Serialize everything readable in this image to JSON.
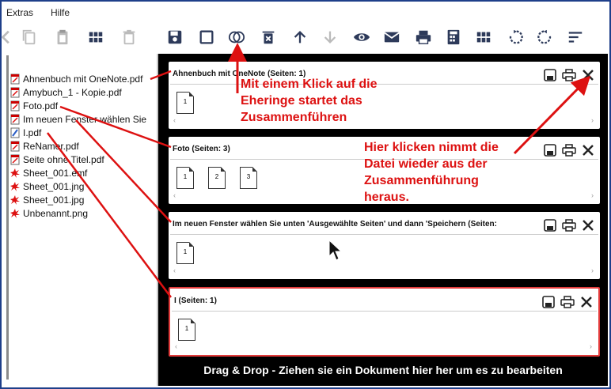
{
  "menu": {
    "items": [
      "Extras",
      "Hilfe"
    ]
  },
  "toolbar": {
    "buttons": [
      "copy-icon",
      "clipboard-icon",
      "grid-icon",
      "trash-icon",
      "save-icon",
      "square-icon",
      "rings-icon",
      "delete-icon",
      "arrow-up-icon",
      "arrow-down-icon",
      "eye-icon",
      "mail-icon",
      "print-icon",
      "calculator-icon",
      "grid-icon",
      "rotate-left-icon",
      "rotate-right-icon",
      "sort-icon"
    ]
  },
  "sidebar": {
    "files": [
      {
        "name": "Ahnenbuch mit OneNote.pdf",
        "type": "pdf"
      },
      {
        "name": "Amybuch_1 - Kopie.pdf",
        "type": "pdf"
      },
      {
        "name": "Foto.pdf",
        "type": "pdf"
      },
      {
        "name": "Im neuen Fenster wählen Sie",
        "type": "pdf"
      },
      {
        "name": "I.pdf",
        "type": "pdf-blue"
      },
      {
        "name": "ReNamer.pdf",
        "type": "pdf"
      },
      {
        "name": "Seite ohne Titel.pdf",
        "type": "pdf"
      },
      {
        "name": "Sheet_001.emf",
        "type": "img"
      },
      {
        "name": "Sheet_001.jng",
        "type": "img"
      },
      {
        "name": "Sheet_001.jpg",
        "type": "img"
      },
      {
        "name": "Unbenannt.png",
        "type": "img"
      }
    ]
  },
  "documents": [
    {
      "title": "Ahnenbuch mit OneNote (Seiten: 1)",
      "pages": [
        "1"
      ]
    },
    {
      "title": "Foto (Seiten: 3)",
      "pages": [
        "1",
        "2",
        "3"
      ]
    },
    {
      "title": "Im neuen Fenster wählen Sie unten 'Ausgewählte Seiten' und dann 'Speichern (Seiten:",
      "pages": [
        "1"
      ]
    },
    {
      "title": "I (Seiten: 1)",
      "pages": [
        "1"
      ]
    }
  ],
  "footer": {
    "text": "Drag & Drop - Ziehen sie ein Dokument hier her um es zu bearbeiten"
  },
  "annotations": {
    "rings": "Mit einem Klick auf die\nEheringe startet das\nZusammenführen",
    "remove": "Hier klicken nimmt die\nDatei wieder aus der\nZusammenführung\nheraus."
  },
  "colors": {
    "accent": "#d11111",
    "frame": "#1e3f8a",
    "selected_border": "#e23b3b"
  }
}
